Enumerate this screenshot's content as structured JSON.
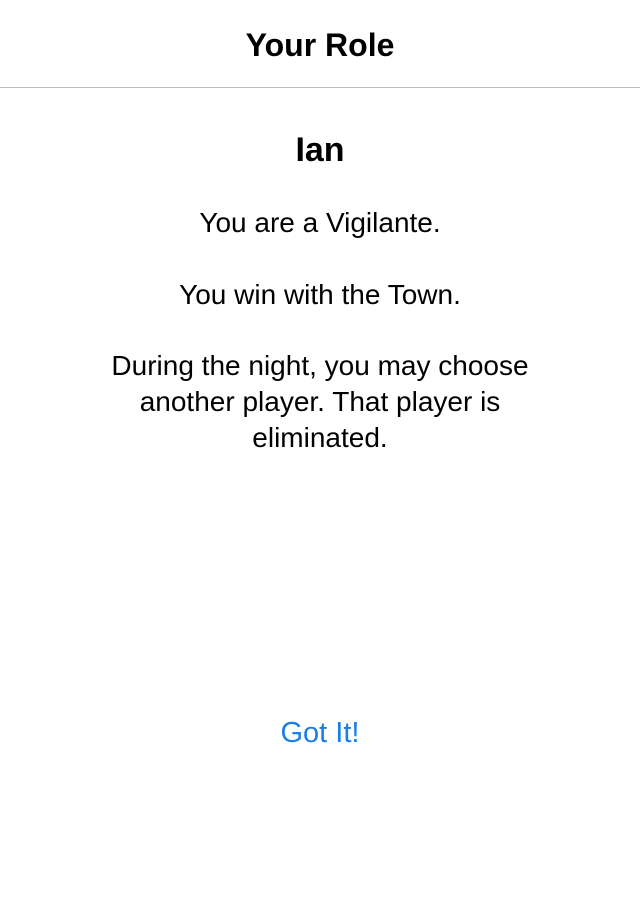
{
  "nav": {
    "title": "Your Role"
  },
  "player": {
    "name": "Ian"
  },
  "role": {
    "description": "You are a Vigilante.",
    "team": "You win with the Town.",
    "ability": "During the night, you may choose another player. That player is eliminated."
  },
  "actions": {
    "confirm_label": "Got It!"
  },
  "colors": {
    "accent": "#1a7ee8",
    "divider": "#bdbdbd",
    "background": "#ffffff",
    "text": "#000000"
  }
}
